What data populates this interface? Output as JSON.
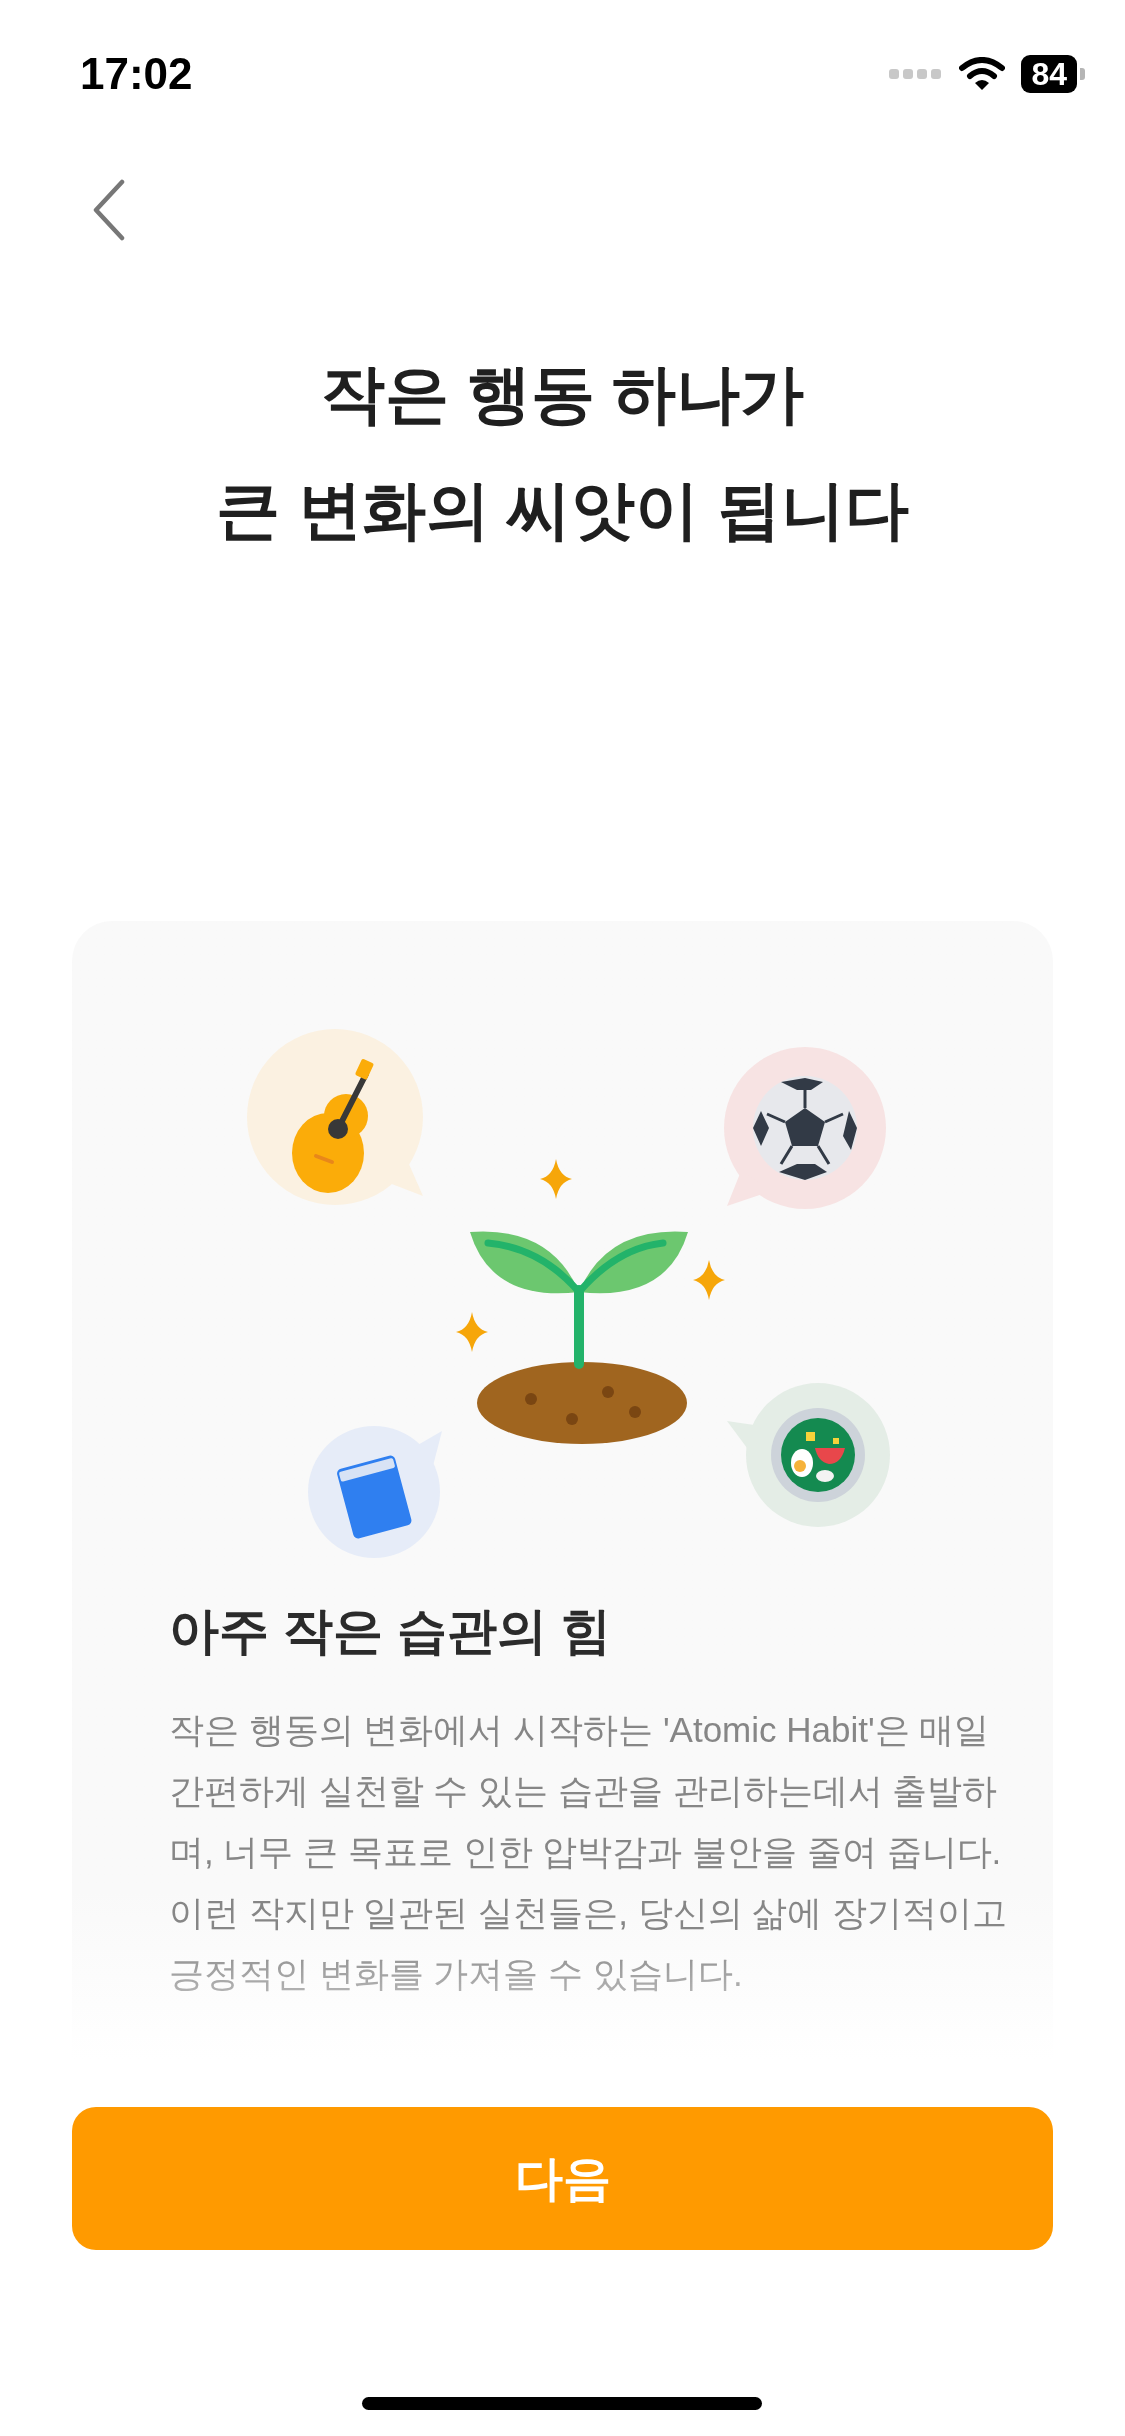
{
  "status_bar": {
    "time": "17:02",
    "battery": "84"
  },
  "title_lines": [
    "작은 행동 하나가",
    "큰 변화의 씨앗이 됩니다"
  ],
  "card": {
    "heading": "아주 작은 습관의 힘",
    "body": "작은 행동의 변화에서 시작하는 'Atomic Habit'은 매일 간편하게 실천할 수 있는 습관을 관리하는데서 출발하며, 너무 큰 목표로 인한 압박감과 불안을 줄여 줍니다. 이런 작지만 일관된 실천들은, 당신의 삶에 장기적이고 긍정적인 변화를 가져올 수 있습니다."
  },
  "next_button": {
    "label": "다음"
  }
}
